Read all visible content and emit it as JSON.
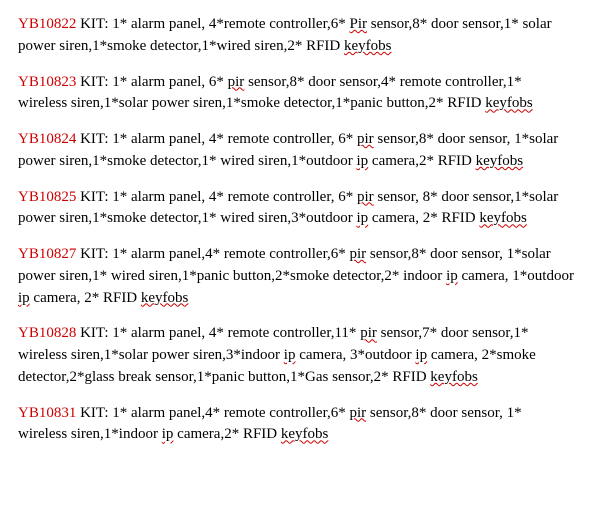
{
  "kits": [
    {
      "id": "YB10822",
      "parts": [
        "KIT: 1* alarm panel, 4*remote controller,6* ",
        {
          "t": "Pir",
          "s": true
        },
        " sensor,8* door sensor,1* solar power siren,1*smoke detector,1*wired siren,2* RFID ",
        {
          "t": "keyfobs",
          "s": true
        }
      ]
    },
    {
      "id": "YB10823",
      "parts": [
        " KIT:  1* alarm panel, 6* ",
        {
          "t": "pir",
          "s": true
        },
        " sensor,8* door sensor,4* remote controller,1* wireless siren,1*solar power siren,1*smoke detector,1*panic button,2* RFID ",
        {
          "t": "keyfobs",
          "s": true
        }
      ]
    },
    {
      "id": "YB10824",
      "parts": [
        " KIT:  1* alarm panel, 4* remote controller, 6* ",
        {
          "t": "pir",
          "s": true
        },
        " sensor,8* door sensor, 1*solar power siren,1*smoke detector,1* wired siren,1*outdoor ",
        {
          "t": "ip",
          "s": true
        },
        " camera,2* RFID ",
        {
          "t": "keyfobs",
          "s": true
        }
      ]
    },
    {
      "id": "YB10825",
      "parts": [
        " KIT: 1* alarm panel, 4* remote controller, 6* ",
        {
          "t": "pir",
          "s": true
        },
        " sensor, 8* door sensor,1*solar power siren,1*smoke detector,1* wired siren,3*outdoor ",
        {
          "t": "ip",
          "s": true
        },
        " camera, 2* RFID ",
        {
          "t": "keyfobs",
          "s": true
        }
      ]
    },
    {
      "id": "YB10827",
      "parts": [
        " KIT:  1* alarm panel,4* remote controller,6* ",
        {
          "t": "pir",
          "s": true
        },
        " sensor,8* door sensor, 1*solar power siren,1* wired siren,1*panic button,2*smoke detector,2* indoor ",
        {
          "t": "ip",
          "s": true
        },
        " camera, 1*outdoor ",
        {
          "t": "ip",
          "s": true
        },
        " camera, 2* RFID ",
        {
          "t": "keyfobs",
          "s": true
        }
      ]
    },
    {
      "id": "YB10828",
      "parts": [
        " KIT: 1* alarm panel, 4* remote controller,11* ",
        {
          "t": "pir",
          "s": true
        },
        " sensor,7* door sensor,1* wireless siren,1*solar power siren,3*indoor ",
        {
          "t": "ip",
          "s": true
        },
        " camera, 3*outdoor ",
        {
          "t": "ip",
          "s": true
        },
        " camera, 2*smoke detector,2*glass break sensor,1*panic button,1*Gas sensor,2* RFID ",
        {
          "t": "keyfobs",
          "s": true
        }
      ]
    },
    {
      "id": "YB10831",
      "parts": [
        " KIT: 1* alarm panel,4* remote controller,6* ",
        {
          "t": "pir",
          "s": true
        },
        " sensor,8* door sensor, 1* wireless siren,1*indoor ",
        {
          "t": "ip",
          "s": true
        },
        " camera,2* RFID ",
        {
          "t": "keyfobs",
          "s": true
        }
      ]
    }
  ]
}
